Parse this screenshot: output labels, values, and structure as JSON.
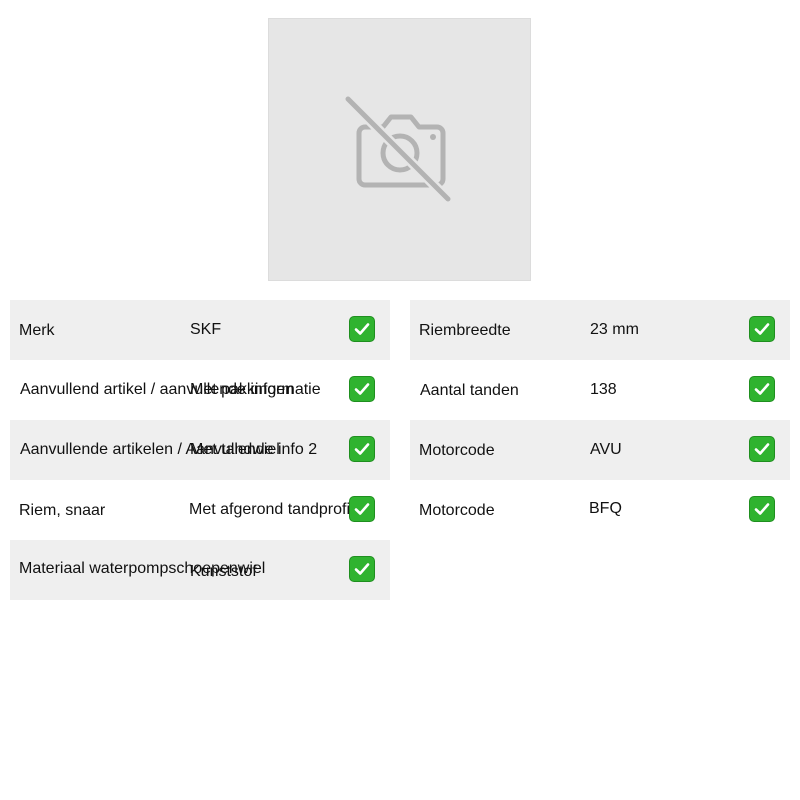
{
  "image": {
    "icon": "camera-off-icon",
    "background_color": "#e6e6e6"
  },
  "specs_left": [
    {
      "label": "Merk",
      "value": "SKF",
      "check_icon": "check-icon"
    },
    {
      "label": "Aanvullend artikel / aanvullende informatie",
      "value": "Met pakkingen",
      "check_icon": "check-icon"
    },
    {
      "label": "Aanvullende artikelen / Aanvullende info 2",
      "value": "Met tandwiel",
      "check_icon": "check-icon"
    },
    {
      "label": "Riem, snaar",
      "value": "Met afgerond tandprofiel",
      "check_icon": "check-icon"
    },
    {
      "label": "Materiaal waterpompschoepenwiel",
      "value": "Kunststof",
      "check_icon": "check-icon"
    }
  ],
  "specs_right": [
    {
      "label": "Riembreedte",
      "value": "23 mm",
      "check_icon": "check-icon"
    },
    {
      "label": "Aantal tanden",
      "value": "138",
      "check_icon": "check-icon"
    },
    {
      "label": "Motorcode",
      "value": "AVU",
      "check_icon": "check-icon"
    },
    {
      "label": "Motorcode",
      "value": "BFQ",
      "check_icon": "check-icon"
    }
  ],
  "colors": {
    "row_shaded": "#efefef",
    "check_green": "#2fb32f",
    "placeholder_gray": "#b3b3b3"
  }
}
